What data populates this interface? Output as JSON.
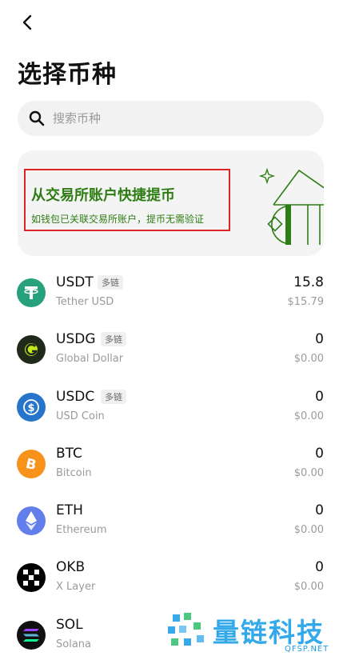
{
  "header": {
    "title": "选择币种"
  },
  "search": {
    "placeholder": "搜索币种"
  },
  "banner": {
    "title": "从交易所账户快捷提币",
    "subtitle": "如钱包已关联交易所账户，提币无需验证"
  },
  "coins": [
    {
      "symbol": "USDT",
      "tag": "多链",
      "name": "Tether USD",
      "amount": "15.8",
      "value": "$15.79",
      "icon": "tether-icon",
      "color": "#26a17b"
    },
    {
      "symbol": "USDG",
      "tag": "多链",
      "name": "Global Dollar",
      "amount": "0",
      "value": "$0.00",
      "icon": "global-dollar-icon",
      "color": "#1f2a1a"
    },
    {
      "symbol": "USDC",
      "tag": "多链",
      "name": "USD Coin",
      "amount": "0",
      "value": "$0.00",
      "icon": "usd-coin-icon",
      "color": "#2775ca"
    },
    {
      "symbol": "BTC",
      "tag": "",
      "name": "Bitcoin",
      "amount": "0",
      "value": "$0.00",
      "icon": "bitcoin-icon",
      "color": "#f7931a"
    },
    {
      "symbol": "ETH",
      "tag": "",
      "name": "Ethereum",
      "amount": "0",
      "value": "$0.00",
      "icon": "ethereum-icon",
      "color": "#627eea"
    },
    {
      "symbol": "OKB",
      "tag": "",
      "name": "X Layer",
      "amount": "0",
      "value": "$0.00",
      "icon": "okb-icon",
      "color": "#000000"
    },
    {
      "symbol": "SOL",
      "tag": "",
      "name": "Solana",
      "amount": "",
      "value": "",
      "icon": "solana-icon",
      "color": "#111111"
    }
  ],
  "watermark": {
    "brand": "量链科技",
    "domain": "QFSP.NET"
  },
  "colors": {
    "accent_green": "#2e7d14",
    "highlight_red": "#e02424",
    "watermark_blue": "#1fa0e8"
  }
}
